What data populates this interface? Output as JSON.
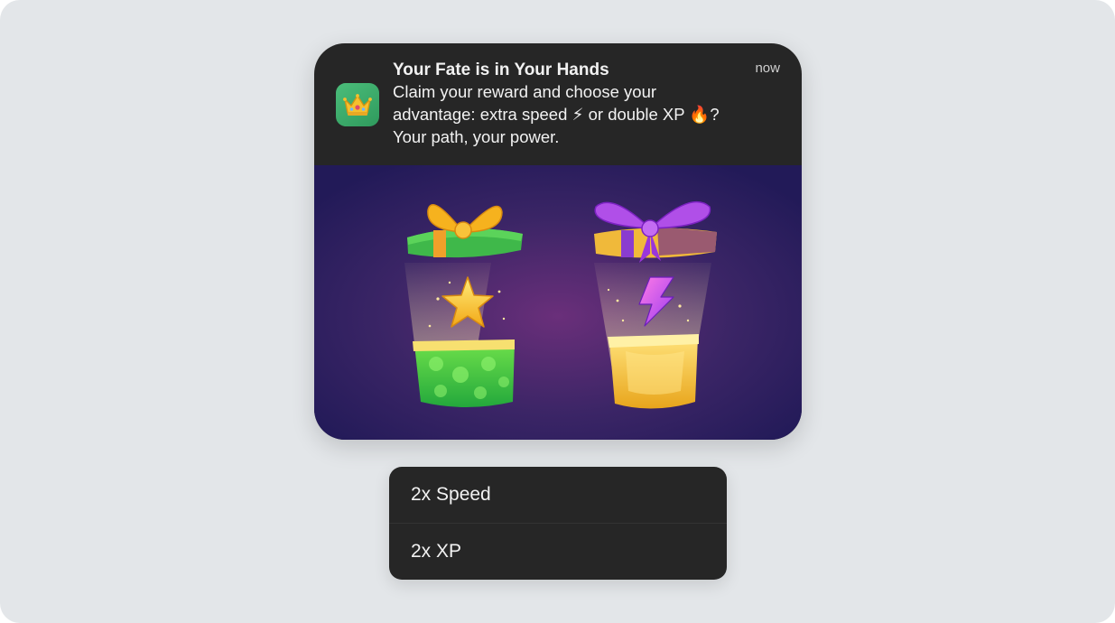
{
  "notification": {
    "app_icon": "crown-icon",
    "title": "Your Fate is in Your Hands",
    "time": "now",
    "body": "Claim your reward and choose your advantage: extra speed ⚡ or double XP 🔥? Your path, your power.",
    "image": {
      "left_gift": "green-gift-box-with-star",
      "right_gift": "yellow-gift-box-with-lightning-bolt"
    }
  },
  "actions": [
    {
      "label": "2x Speed"
    },
    {
      "label": "2x XP"
    }
  ],
  "colors": {
    "background": "#e3e6e9",
    "card": "#262626",
    "text": "#f2f2f2",
    "app_icon": "#3aa96a",
    "image_bg": "#3a2468"
  }
}
